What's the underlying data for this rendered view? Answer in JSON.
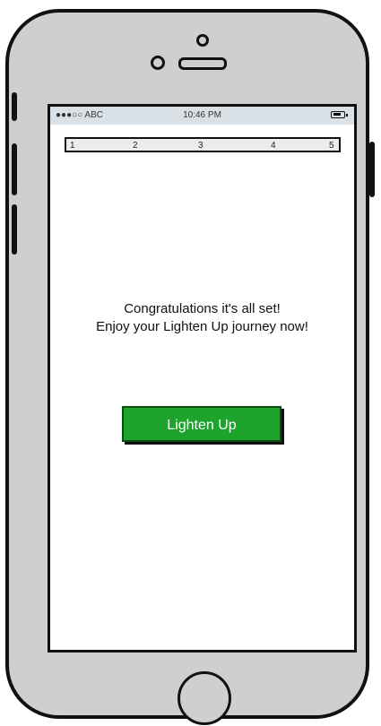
{
  "status_bar": {
    "carrier": "●●●○○ ABC",
    "time": "10:46 PM"
  },
  "steps": [
    "1",
    "2",
    "3",
    "4",
    "5"
  ],
  "message": {
    "line1": "Congratulations it's all set!",
    "line2": "Enjoy your Lighten Up journey now!"
  },
  "cta_label": "Lighten Up",
  "colors": {
    "cta_bg": "#1ea32c",
    "status_bar_bg": "#d9e1e7"
  }
}
